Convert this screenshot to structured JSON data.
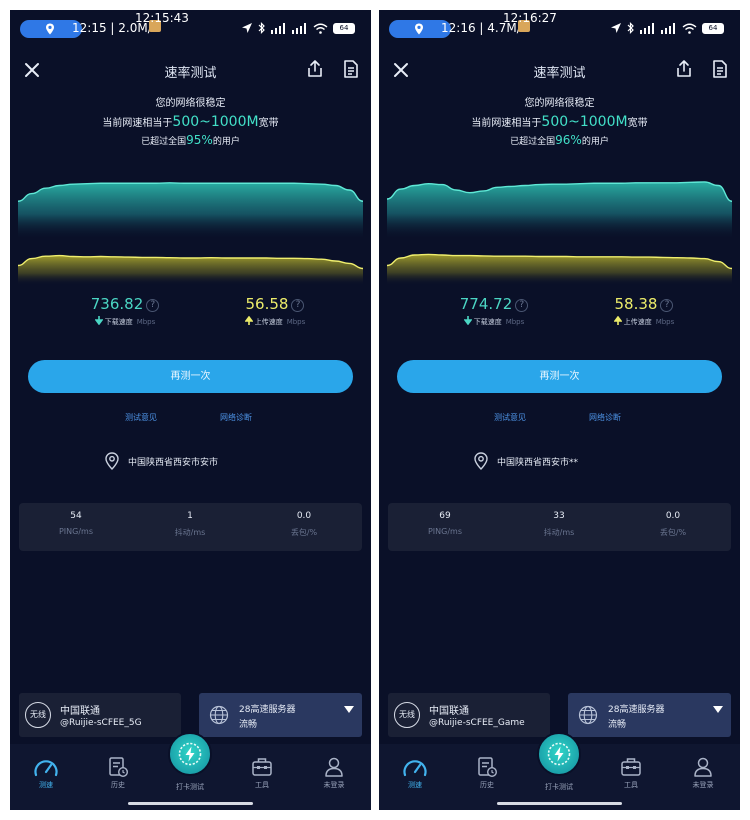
{
  "screens": [
    {
      "status_time": "12:15 | 2.0M/s",
      "overlay_clock": "12:15:43",
      "battery": "64",
      "title": "速率测试",
      "summary": {
        "line1": "您的网络很稳定",
        "line2_prefix": "当前网速相当于",
        "line2_value": "500~1000M",
        "line2_suffix": "宽带",
        "line3_prefix": "已超过全国",
        "line3_value": "95%",
        "line3_suffix": "的用户"
      },
      "download": {
        "value": "736.82",
        "label": "下载速度",
        "unit": "Mbps"
      },
      "upload": {
        "value": "56.58",
        "label": "上传速度",
        "unit": "Mbps"
      },
      "retest_label": "再测一次",
      "feedback_label": "测试意见",
      "diagnose_label": "网络诊断",
      "location": "中国陕西省西安市安市",
      "stats": [
        {
          "value": "54",
          "label": "PING/ms"
        },
        {
          "value": "1",
          "label": "抖动/ms"
        },
        {
          "value": "0.0",
          "label": "丢包/%"
        }
      ],
      "connection": {
        "type": "无线",
        "carrier": "中国联通",
        "ssid": "@Ruijie-sCFEE_5G"
      },
      "server": {
        "name": "28高速服务器",
        "status": "流畅"
      },
      "nav": {
        "speed": "测速",
        "history": "历史",
        "checkin": "打卡测试",
        "tools": "工具",
        "login": "未登录"
      },
      "graph": {
        "download_profile": [
          0.55,
          0.72,
          0.84,
          0.9,
          0.93,
          0.94,
          0.95,
          0.95,
          0.95,
          0.95,
          0.95,
          0.96,
          0.95,
          0.95,
          0.95,
          0.95,
          0.95,
          0.95,
          0.95,
          0.95,
          0.95,
          0.94,
          0.93,
          0.9,
          0.8,
          0.55
        ],
        "upload_profile": [
          0.55,
          0.78,
          0.86,
          0.88,
          0.85,
          0.84,
          0.85,
          0.84,
          0.83,
          0.82,
          0.82,
          0.81,
          0.8,
          0.8,
          0.81,
          0.8,
          0.8,
          0.8,
          0.8,
          0.79,
          0.79,
          0.78,
          0.76,
          0.7,
          0.62,
          0.45
        ]
      }
    },
    {
      "status_time": "12:16 | 4.7M/s",
      "overlay_clock": "12:16:27",
      "battery": "64",
      "title": "速率测试",
      "summary": {
        "line1": "您的网络很稳定",
        "line2_prefix": "当前网速相当于",
        "line2_value": "500~1000M",
        "line2_suffix": "宽带",
        "line3_prefix": "已超过全国",
        "line3_value": "96%",
        "line3_suffix": "的用户"
      },
      "download": {
        "value": "774.72",
        "label": "下载速度",
        "unit": "Mbps"
      },
      "upload": {
        "value": "58.38",
        "label": "上传速度",
        "unit": "Mbps"
      },
      "retest_label": "再测一次",
      "feedback_label": "测试意见",
      "diagnose_label": "网络诊断",
      "location": "中国陕西省西安市**",
      "stats": [
        {
          "value": "69",
          "label": "PING/ms"
        },
        {
          "value": "33",
          "label": "抖动/ms"
        },
        {
          "value": "0.0",
          "label": "丢包/%"
        }
      ],
      "connection": {
        "type": "无线",
        "carrier": "中国联通",
        "ssid": "@Ruijie-sCFEE_Game"
      },
      "server": {
        "name": "28高速服务器",
        "status": "流畅"
      },
      "nav": {
        "speed": "测速",
        "history": "历史",
        "checkin": "打卡测试",
        "tools": "工具",
        "login": "未登录"
      },
      "graph": {
        "download_profile": [
          0.6,
          0.82,
          0.9,
          0.94,
          0.92,
          0.8,
          0.74,
          0.78,
          0.86,
          0.88,
          0.9,
          0.92,
          0.93,
          0.93,
          0.94,
          0.95,
          0.95,
          0.95,
          0.96,
          0.96,
          0.96,
          0.96,
          0.97,
          0.98,
          0.9,
          0.55
        ],
        "upload_profile": [
          0.55,
          0.8,
          0.9,
          0.92,
          0.9,
          0.88,
          0.88,
          0.87,
          0.86,
          0.86,
          0.86,
          0.85,
          0.85,
          0.85,
          0.84,
          0.84,
          0.84,
          0.84,
          0.83,
          0.83,
          0.82,
          0.81,
          0.8,
          0.78,
          0.68,
          0.45
        ]
      }
    }
  ],
  "colors": {
    "background": "#0a1028",
    "download": "#4bd6c4",
    "upload": "#ecec6a",
    "accent": "#42e0c8",
    "button": "#2aa6ea",
    "link": "#4e95e8"
  }
}
